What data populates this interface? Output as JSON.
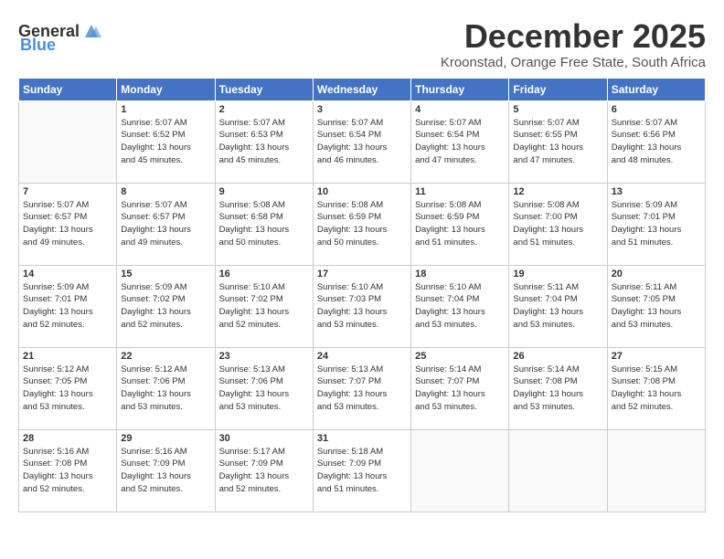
{
  "logo": {
    "general": "General",
    "blue": "Blue"
  },
  "header": {
    "title": "December 2025",
    "subtitle": "Kroonstad, Orange Free State, South Africa"
  },
  "weekdays": [
    "Sunday",
    "Monday",
    "Tuesday",
    "Wednesday",
    "Thursday",
    "Friday",
    "Saturday"
  ],
  "weeks": [
    [
      {
        "day": "",
        "info": ""
      },
      {
        "day": "1",
        "info": "Sunrise: 5:07 AM\nSunset: 6:52 PM\nDaylight: 13 hours\nand 45 minutes."
      },
      {
        "day": "2",
        "info": "Sunrise: 5:07 AM\nSunset: 6:53 PM\nDaylight: 13 hours\nand 45 minutes."
      },
      {
        "day": "3",
        "info": "Sunrise: 5:07 AM\nSunset: 6:54 PM\nDaylight: 13 hours\nand 46 minutes."
      },
      {
        "day": "4",
        "info": "Sunrise: 5:07 AM\nSunset: 6:54 PM\nDaylight: 13 hours\nand 47 minutes."
      },
      {
        "day": "5",
        "info": "Sunrise: 5:07 AM\nSunset: 6:55 PM\nDaylight: 13 hours\nand 47 minutes."
      },
      {
        "day": "6",
        "info": "Sunrise: 5:07 AM\nSunset: 6:56 PM\nDaylight: 13 hours\nand 48 minutes."
      }
    ],
    [
      {
        "day": "7",
        "info": "Sunrise: 5:07 AM\nSunset: 6:57 PM\nDaylight: 13 hours\nand 49 minutes."
      },
      {
        "day": "8",
        "info": "Sunrise: 5:07 AM\nSunset: 6:57 PM\nDaylight: 13 hours\nand 49 minutes."
      },
      {
        "day": "9",
        "info": "Sunrise: 5:08 AM\nSunset: 6:58 PM\nDaylight: 13 hours\nand 50 minutes."
      },
      {
        "day": "10",
        "info": "Sunrise: 5:08 AM\nSunset: 6:59 PM\nDaylight: 13 hours\nand 50 minutes."
      },
      {
        "day": "11",
        "info": "Sunrise: 5:08 AM\nSunset: 6:59 PM\nDaylight: 13 hours\nand 51 minutes."
      },
      {
        "day": "12",
        "info": "Sunrise: 5:08 AM\nSunset: 7:00 PM\nDaylight: 13 hours\nand 51 minutes."
      },
      {
        "day": "13",
        "info": "Sunrise: 5:09 AM\nSunset: 7:01 PM\nDaylight: 13 hours\nand 51 minutes."
      }
    ],
    [
      {
        "day": "14",
        "info": "Sunrise: 5:09 AM\nSunset: 7:01 PM\nDaylight: 13 hours\nand 52 minutes."
      },
      {
        "day": "15",
        "info": "Sunrise: 5:09 AM\nSunset: 7:02 PM\nDaylight: 13 hours\nand 52 minutes."
      },
      {
        "day": "16",
        "info": "Sunrise: 5:10 AM\nSunset: 7:02 PM\nDaylight: 13 hours\nand 52 minutes."
      },
      {
        "day": "17",
        "info": "Sunrise: 5:10 AM\nSunset: 7:03 PM\nDaylight: 13 hours\nand 53 minutes."
      },
      {
        "day": "18",
        "info": "Sunrise: 5:10 AM\nSunset: 7:04 PM\nDaylight: 13 hours\nand 53 minutes."
      },
      {
        "day": "19",
        "info": "Sunrise: 5:11 AM\nSunset: 7:04 PM\nDaylight: 13 hours\nand 53 minutes."
      },
      {
        "day": "20",
        "info": "Sunrise: 5:11 AM\nSunset: 7:05 PM\nDaylight: 13 hours\nand 53 minutes."
      }
    ],
    [
      {
        "day": "21",
        "info": "Sunrise: 5:12 AM\nSunset: 7:05 PM\nDaylight: 13 hours\nand 53 minutes."
      },
      {
        "day": "22",
        "info": "Sunrise: 5:12 AM\nSunset: 7:06 PM\nDaylight: 13 hours\nand 53 minutes."
      },
      {
        "day": "23",
        "info": "Sunrise: 5:13 AM\nSunset: 7:06 PM\nDaylight: 13 hours\nand 53 minutes."
      },
      {
        "day": "24",
        "info": "Sunrise: 5:13 AM\nSunset: 7:07 PM\nDaylight: 13 hours\nand 53 minutes."
      },
      {
        "day": "25",
        "info": "Sunrise: 5:14 AM\nSunset: 7:07 PM\nDaylight: 13 hours\nand 53 minutes."
      },
      {
        "day": "26",
        "info": "Sunrise: 5:14 AM\nSunset: 7:08 PM\nDaylight: 13 hours\nand 53 minutes."
      },
      {
        "day": "27",
        "info": "Sunrise: 5:15 AM\nSunset: 7:08 PM\nDaylight: 13 hours\nand 52 minutes."
      }
    ],
    [
      {
        "day": "28",
        "info": "Sunrise: 5:16 AM\nSunset: 7:08 PM\nDaylight: 13 hours\nand 52 minutes."
      },
      {
        "day": "29",
        "info": "Sunrise: 5:16 AM\nSunset: 7:09 PM\nDaylight: 13 hours\nand 52 minutes."
      },
      {
        "day": "30",
        "info": "Sunrise: 5:17 AM\nSunset: 7:09 PM\nDaylight: 13 hours\nand 52 minutes."
      },
      {
        "day": "31",
        "info": "Sunrise: 5:18 AM\nSunset: 7:09 PM\nDaylight: 13 hours\nand 51 minutes."
      },
      {
        "day": "",
        "info": ""
      },
      {
        "day": "",
        "info": ""
      },
      {
        "day": "",
        "info": ""
      }
    ]
  ]
}
